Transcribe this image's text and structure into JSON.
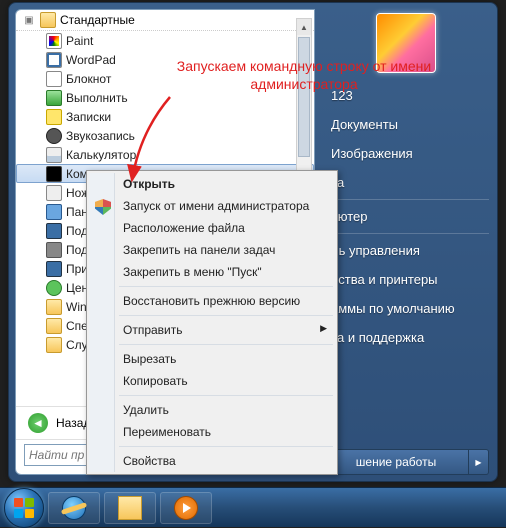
{
  "annotation": {
    "line1": "Запускаем командную строку от имени",
    "line2": "администратора"
  },
  "start_menu": {
    "header_folder": "Стандартные",
    "programs": [
      {
        "name": "Paint",
        "icon": "i-paint"
      },
      {
        "name": "WordPad",
        "icon": "i-wordpad"
      },
      {
        "name": "Блокнот",
        "icon": "i-notepad"
      },
      {
        "name": "Выполнить",
        "icon": "i-run"
      },
      {
        "name": "Записки",
        "icon": "i-notes"
      },
      {
        "name": "Звукозапись",
        "icon": "i-sound"
      },
      {
        "name": "Калькулятор",
        "icon": "i-calc"
      },
      {
        "name": "Кома",
        "icon": "i-cmd",
        "selected": true
      },
      {
        "name": "Ножн",
        "icon": "i-scis"
      },
      {
        "name": "Пане",
        "icon": "i-tablet"
      },
      {
        "name": "Подк",
        "icon": "i-rdp"
      },
      {
        "name": "Подк",
        "icon": "i-proj"
      },
      {
        "name": "Прис",
        "icon": "i-rdp"
      },
      {
        "name": "Ценр",
        "icon": "i-sync"
      },
      {
        "name": "Windo",
        "icon": "i-folder"
      },
      {
        "name": "Спец",
        "icon": "i-folder"
      },
      {
        "name": "Служ",
        "icon": "i-folder"
      }
    ],
    "back_label": "Назад",
    "search_placeholder": "Найти пр"
  },
  "right_pane": {
    "username": "123",
    "items": [
      "Документы",
      "Изображения",
      "ка",
      "",
      "ьютер",
      "ль управления",
      "йства и принтеры",
      "аммы по умолчанию",
      "ка и поддержка"
    ],
    "shutdown_label": "шение работы"
  },
  "context_menu": {
    "items": [
      {
        "label": "Открыть",
        "bold": true
      },
      {
        "label": "Запуск от имени администратора",
        "shield": true
      },
      {
        "label": "Расположение файла"
      },
      {
        "label": "Закрепить на панели задач"
      },
      {
        "label": "Закрепить в меню \"Пуск\""
      },
      {
        "sep": true
      },
      {
        "label": "Восстановить прежнюю версию"
      },
      {
        "sep": true
      },
      {
        "label": "Отправить",
        "submenu": true
      },
      {
        "sep": true
      },
      {
        "label": "Вырезать"
      },
      {
        "label": "Копировать"
      },
      {
        "sep": true
      },
      {
        "label": "Удалить"
      },
      {
        "label": "Переименовать"
      },
      {
        "sep": true
      },
      {
        "label": "Свойства"
      }
    ]
  },
  "taskbar": {
    "buttons": [
      "ie-icon",
      "explorer-icon",
      "wmp-icon"
    ]
  }
}
